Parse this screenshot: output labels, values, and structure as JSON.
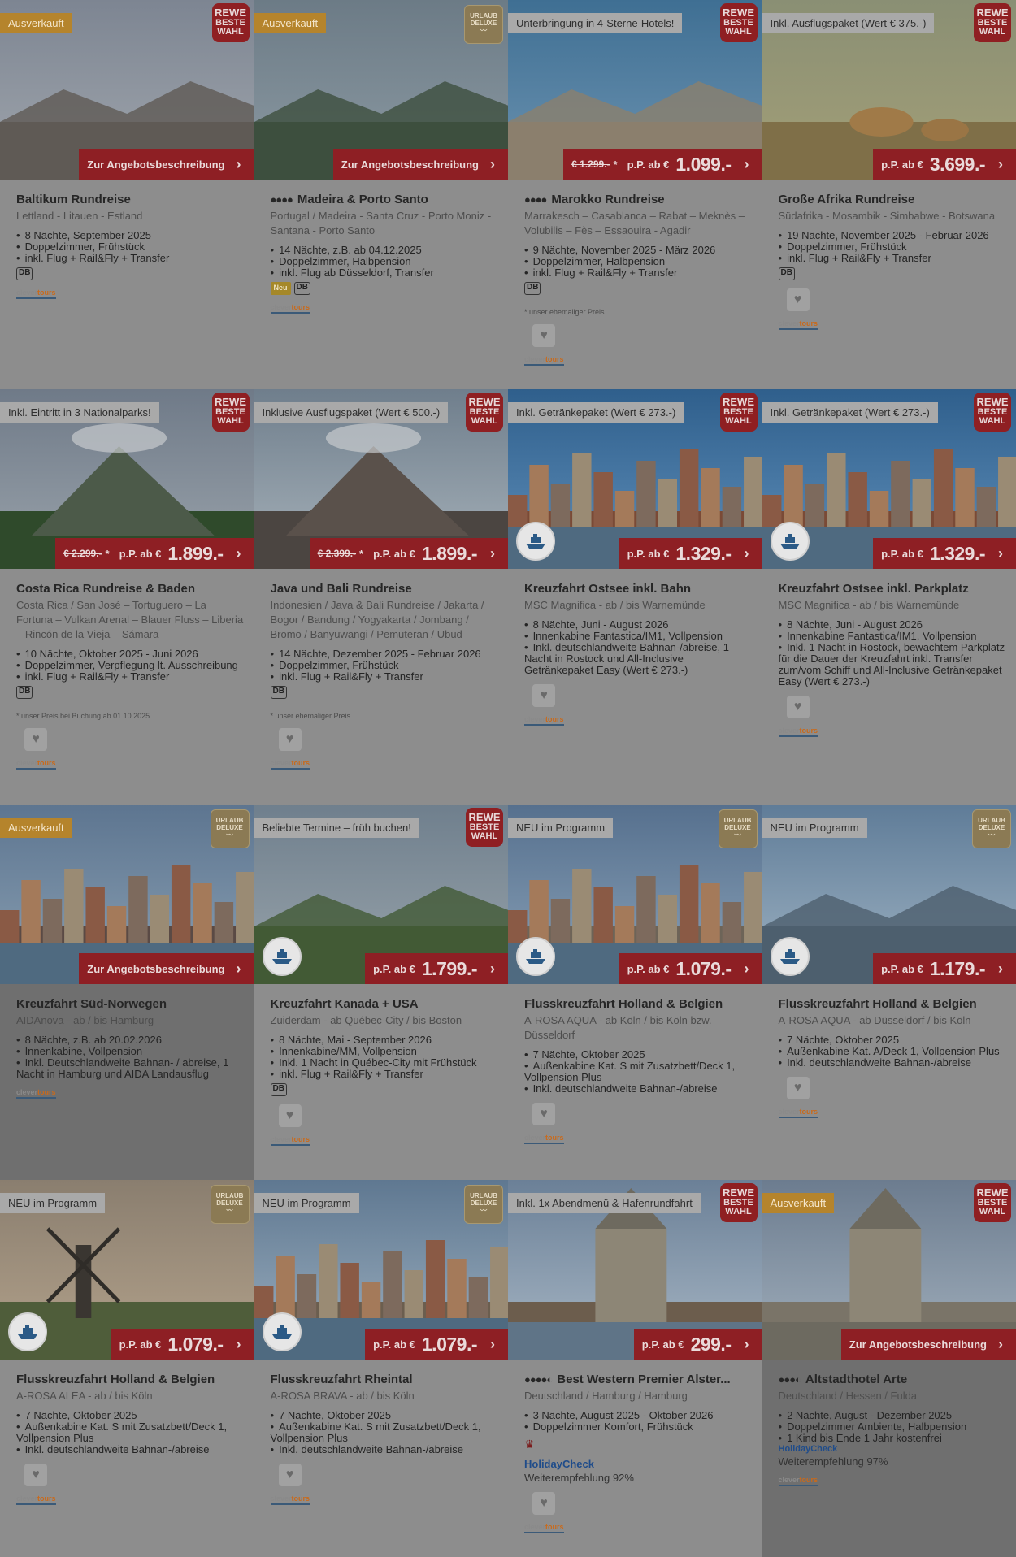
{
  "cards": [
    {
      "id": "baltikum",
      "row": 0,
      "col": 0,
      "dim": false,
      "scene": "city",
      "badge": {
        "text": "Ausverkauft",
        "style": "orange"
      },
      "seal": "rewe",
      "cta": {
        "label": "Zur Angebotsbeschreibung"
      },
      "ship": false,
      "title": "Baltikum Rundreise",
      "stars": "",
      "sub": "Lettland - Litauen - Estland",
      "features": [
        "8 Nächte, September 2025",
        "Doppelzimmer, Frühstück",
        "inkl. Flug + Rail&Fly + Transfer"
      ],
      "db": true,
      "neu": false,
      "note": "",
      "fav": false,
      "logo": true
    },
    {
      "id": "madeira",
      "row": 0,
      "col": 1,
      "dim": false,
      "scene": "coast",
      "badge": {
        "text": "Ausverkauft",
        "style": "orange"
      },
      "seal": "deluxe",
      "cta": {
        "label": "Zur Angebotsbeschreibung"
      },
      "ship": false,
      "title": "Madeira & Porto Santo",
      "stars": "●●●●",
      "sub": "Portugal / Madeira - Santa Cruz - Porto Moniz - Santana - Porto Santo",
      "features": [
        "14 Nächte, z.B. ab 04.12.2025",
        "Doppelzimmer, Halbpension",
        "inkl. Flug ab Düsseldorf, Transfer"
      ],
      "db": true,
      "neu": true,
      "note": "",
      "fav": false,
      "logo": true
    },
    {
      "id": "marokko",
      "row": 0,
      "col": 2,
      "dim": false,
      "scene": "coast-city",
      "badge": {
        "text": "Unterbringung in 4-Sterne-Hotels!",
        "style": "grey"
      },
      "seal": "rewe",
      "cta": {
        "old": "€ 1.299.-",
        "star": "*",
        "prefix": "p.P. ab €",
        "price": "1.099.-"
      },
      "ship": false,
      "title": "Marokko Rundreise",
      "stars": "●●●●",
      "sub": "Marrakesch – Casablanca – Rabat – Meknès – Volubilis – Fès – Essaouira - Agadir",
      "features": [
        "9 Nächte, November 2025 - März 2026",
        "Doppelzimmer, Halbpension",
        "inkl. Flug + Rail&Fly + Transfer"
      ],
      "db": true,
      "neu": false,
      "note": "* unser ehemaliger Preis",
      "fav": true,
      "logo": true
    },
    {
      "id": "afrika",
      "row": 0,
      "col": 3,
      "dim": false,
      "scene": "savanna",
      "badge": {
        "text": "Inkl. Ausflugspaket (Wert € 375.-)",
        "style": "grey"
      },
      "seal": "rewe",
      "cta": {
        "prefix": "p.P. ab €",
        "price": "3.699.-"
      },
      "ship": false,
      "title": "Große Afrika Rundreise",
      "stars": "",
      "sub": "Südafrika - Mosambik - Simbabwe - Botswana",
      "features": [
        "19 Nächte, November 2025 - Februar 2026",
        "Doppelzimmer, Frühstück",
        "inkl. Flug + Rail&Fly + Transfer"
      ],
      "db": true,
      "neu": false,
      "note": "",
      "fav": true,
      "logo": true
    },
    {
      "id": "costarica",
      "row": 1,
      "col": 0,
      "dim": false,
      "scene": "volcano-green",
      "badge": {
        "text": "Inkl. Eintritt in 3 Nationalparks!",
        "style": "grey"
      },
      "seal": "rewe",
      "cta": {
        "old": "€ 2.299.-",
        "star": "*",
        "prefix": "p.P. ab €",
        "price": "1.899.-"
      },
      "ship": false,
      "title": "Costa Rica Rundreise & Baden",
      "stars": "",
      "sub": "Costa Rica / San José – Tortuguero – La Fortuna – Vulkan Arenal – Blauer Fluss – Liberia – Rincón de la Vieja – Sámara",
      "features": [
        "10 Nächte, Oktober 2025 - Juni 2026",
        "Doppelzimmer, Verpflegung lt. Ausschreibung",
        "inkl. Flug + Rail&Fly + Transfer"
      ],
      "db": true,
      "neu": false,
      "note": "* unser Preis bei Buchung ab 01.10.2025",
      "fav": true,
      "logo": true
    },
    {
      "id": "javabali",
      "row": 1,
      "col": 1,
      "dim": false,
      "scene": "volcano-dark",
      "badge": {
        "text": "Inklusive Ausflugspaket (Wert € 500.-)",
        "style": "grey"
      },
      "seal": "rewe",
      "cta": {
        "old": "€ 2.399.-",
        "star": "*",
        "prefix": "p.P. ab €",
        "price": "1.899.-"
      },
      "ship": false,
      "title": "Java und Bali Rundreise",
      "stars": "",
      "sub": "Indonesien / Java & Bali Rundreise / Jakarta / Bogor / Bandung / Yogyakarta / Jombang / Bromo / Banyuwangi / Pemuteran / Ubud",
      "features": [
        "14 Nächte, Dezember 2025 - Februar 2026",
        "Doppelzimmer, Frühstück",
        "inkl. Flug + Rail&Fly + Transfer"
      ],
      "db": true,
      "neu": false,
      "note": "* unser ehemaliger Preis",
      "fav": true,
      "logo": true
    },
    {
      "id": "ostsee-bahn",
      "row": 1,
      "col": 2,
      "dim": false,
      "scene": "gdansk",
      "badge": {
        "text": "Inkl. Getränkepaket (Wert € 273.-)",
        "style": "grey"
      },
      "seal": "rewe",
      "cta": {
        "prefix": "p.P. ab €",
        "price": "1.329.-"
      },
      "ship": true,
      "title": "Kreuzfahrt Ostsee inkl. Bahn",
      "stars": "",
      "sub": "MSC Magnifica - ab / bis Warnemünde",
      "features": [
        "8 Nächte, Juni - August 2026",
        "Innenkabine Fantastica/IM1, Vollpension",
        "Inkl. deutschlandweite Bahnan-/abreise, 1 Nacht in Rostock und All-Inclusive Getränkepaket Easy (Wert € 273.-)"
      ],
      "db": false,
      "neu": false,
      "note": "",
      "fav": true,
      "logo": true
    },
    {
      "id": "ostsee-park",
      "row": 1,
      "col": 3,
      "dim": false,
      "scene": "gdansk",
      "badge": {
        "text": "Inkl. Getränkepaket (Wert € 273.-)",
        "style": "grey"
      },
      "seal": "rewe",
      "cta": {
        "prefix": "p.P. ab €",
        "price": "1.329.-"
      },
      "ship": true,
      "title": "Kreuzfahrt Ostsee inkl. Parkplatz",
      "stars": "",
      "sub": "MSC Magnifica - ab / bis Warnemünde",
      "features": [
        "8 Nächte, Juni - August 2026",
        "Innenkabine Fantastica/IM1, Vollpension",
        "Inkl. 1 Nacht in Rostock, bewachtem Parkplatz für die Dauer der Kreuzfahrt inkl. Transfer zum/vom Schiff und All-Inclusive Getränkepaket Easy (Wert € 273.-)"
      ],
      "db": false,
      "neu": false,
      "note": "",
      "fav": true,
      "logo": true
    },
    {
      "id": "norwegen",
      "row": 2,
      "col": 0,
      "dim": true,
      "scene": "bergen",
      "badge": {
        "text": "Ausverkauft",
        "style": "orange"
      },
      "seal": "deluxe",
      "cta": {
        "label": "Zur Angebotsbeschreibung"
      },
      "ship": false,
      "title": "Kreuzfahrt Süd-Norwegen",
      "stars": "",
      "sub": "AIDAnova - ab / bis Hamburg",
      "features": [
        "8 Nächte, z.B. ab 20.02.2026",
        "Innenkabine, Vollpension",
        "Inkl. Deutschlandweite Bahnan- / abreise, 1 Nacht in Hamburg und AIDA Landausflug"
      ],
      "db": false,
      "neu": false,
      "note": "",
      "fav": false,
      "logo": true
    },
    {
      "id": "kanada",
      "row": 2,
      "col": 1,
      "dim": false,
      "scene": "cliffs",
      "badge": {
        "text": "Beliebte Termine – früh buchen!",
        "style": "grey"
      },
      "seal": "rewe",
      "cta": {
        "prefix": "p.P. ab €",
        "price": "1.799.-"
      },
      "ship": true,
      "title": "Kreuzfahrt Kanada + USA",
      "stars": "",
      "sub": "Zuiderdam - ab Québec-City / bis Boston",
      "features": [
        "8 Nächte, Mai - September 2026",
        "Innenkabine/MM, Vollpension",
        "Inkl. 1 Nacht in Québec-City mit Frühstück",
        "inkl. Flug + Rail&Fly + Transfer"
      ],
      "db": true,
      "neu": false,
      "note": "",
      "fav": true,
      "logo": true
    },
    {
      "id": "holland1",
      "row": 2,
      "col": 2,
      "dim": false,
      "scene": "brussels",
      "badge": {
        "text": "NEU im Programm",
        "style": "grey"
      },
      "seal": "deluxe",
      "cta": {
        "prefix": "p.P. ab €",
        "price": "1.079.-"
      },
      "ship": true,
      "title": "Flusskreuzfahrt Holland & Belgien",
      "stars": "",
      "sub": "A-ROSA AQUA - ab Köln / bis Köln bzw. Düsseldorf",
      "features": [
        "7 Nächte, Oktober 2025",
        "Außenkabine Kat. S mit Zusatzbett/Deck 1, Vollpension Plus",
        "Inkl. deutschlandweite Bahnan-/abreise"
      ],
      "db": false,
      "neu": false,
      "note": "",
      "fav": true,
      "logo": true
    },
    {
      "id": "holland2",
      "row": 2,
      "col": 3,
      "dim": false,
      "scene": "harbor",
      "badge": {
        "text": "NEU im Programm",
        "style": "grey"
      },
      "seal": "deluxe",
      "cta": {
        "prefix": "p.P. ab €",
        "price": "1.179.-"
      },
      "ship": true,
      "title": "Flusskreuzfahrt Holland & Belgien",
      "stars": "",
      "sub": "A-ROSA AQUA - ab Düsseldorf / bis Köln",
      "features": [
        "7 Nächte, Oktober 2025",
        "Außenkabine Kat. A/Deck 1, Vollpension Plus",
        "Inkl. deutschlandweite Bahnan-/abreise"
      ],
      "db": false,
      "neu": false,
      "note": "",
      "fav": true,
      "logo": true
    },
    {
      "id": "holland3",
      "row": 3,
      "col": 0,
      "dim": false,
      "scene": "windmill",
      "badge": {
        "text": "NEU im Programm",
        "style": "grey"
      },
      "seal": "deluxe",
      "cta": {
        "prefix": "p.P. ab €",
        "price": "1.079.-"
      },
      "ship": true,
      "title": "Flusskreuzfahrt Holland & Belgien",
      "stars": "",
      "sub": "A-ROSA ALEA - ab / bis Köln",
      "features": [
        "7 Nächte, Oktober 2025",
        "Außenkabine Kat. S mit Zusatzbett/Deck 1, Vollpension Plus",
        "Inkl. deutschlandweite Bahnan-/abreise"
      ],
      "db": false,
      "neu": false,
      "note": "",
      "fav": true,
      "logo": true
    },
    {
      "id": "rheintal",
      "row": 3,
      "col": 1,
      "dim": false,
      "scene": "timber",
      "badge": {
        "text": "NEU im Programm",
        "style": "grey"
      },
      "seal": "deluxe",
      "cta": {
        "prefix": "p.P. ab €",
        "price": "1.079.-"
      },
      "ship": true,
      "title": "Flusskreuzfahrt Rheintal",
      "stars": "",
      "sub": "A-ROSA BRAVA - ab / bis Köln",
      "features": [
        "7 Nächte, Oktober 2025",
        "Außenkabine Kat. S mit Zusatzbett/Deck 1, Vollpension Plus",
        "Inkl. deutschlandweite Bahnan-/abreise"
      ],
      "db": false,
      "neu": false,
      "note": "",
      "fav": true,
      "logo": true
    },
    {
      "id": "alster",
      "row": 3,
      "col": 2,
      "dim": false,
      "scene": "hamburg",
      "badge": {
        "text": "Inkl. 1x Abendmenü & Hafenrundfahrt",
        "style": "grey"
      },
      "seal": "rewe",
      "cta": {
        "prefix": "p.P. ab €",
        "price": "299.-"
      },
      "ship": false,
      "title": "Best Western Premier Alster...",
      "stars": "●●●●◐",
      "sub": "Deutschland / Hamburg / Hamburg",
      "features": [
        "3 Nächte, August 2025 - Oktober 2026",
        "Doppelzimmer Komfort, Frühstück"
      ],
      "db": false,
      "neu": false,
      "note": "",
      "bw": true,
      "hc": {
        "logo": "HolidayCheck",
        "text": "Weiterempfehlung 92%"
      },
      "fav": true,
      "logo": true
    },
    {
      "id": "arte",
      "row": 3,
      "col": 3,
      "dim": true,
      "scene": "cathedral",
      "badge": {
        "text": "Ausverkauft",
        "style": "orange"
      },
      "seal": "rewe",
      "cta": {
        "label": "Zur Angebotsbeschreibung"
      },
      "ship": false,
      "title": "Altstadthotel Arte",
      "stars": "●●●◐",
      "sub": "Deutschland / Hessen / Fulda",
      "features": [
        "2 Nächte, August - Dezember 2025",
        "Doppelzimmer Ambiente, Halbpension",
        "1 Kind bis Ende 1 Jahr kostenfrei"
      ],
      "db": false,
      "neu": false,
      "note": "",
      "hcSmall": {
        "logo": "HolidayCheck",
        "text": "Weiterempfehlung 97%"
      },
      "fav": false,
      "logo": true
    }
  ],
  "labels": {
    "rewe_top": "REWE",
    "rewe_mid": "BESTE",
    "rewe_bot": "WAHL",
    "deluxe_top": "URLAUB",
    "deluxe_bot": "DELUXE",
    "db": "DB",
    "neu": "Neu",
    "logo_a": "clever",
    "logo_b": "tours",
    ".com": ".com",
    "arrow": "›",
    "heart": "♥"
  },
  "colors": {
    "accent": "#8e1f24",
    "badge_orange": "#b5842c",
    "overlay": "#7e7e7e"
  }
}
